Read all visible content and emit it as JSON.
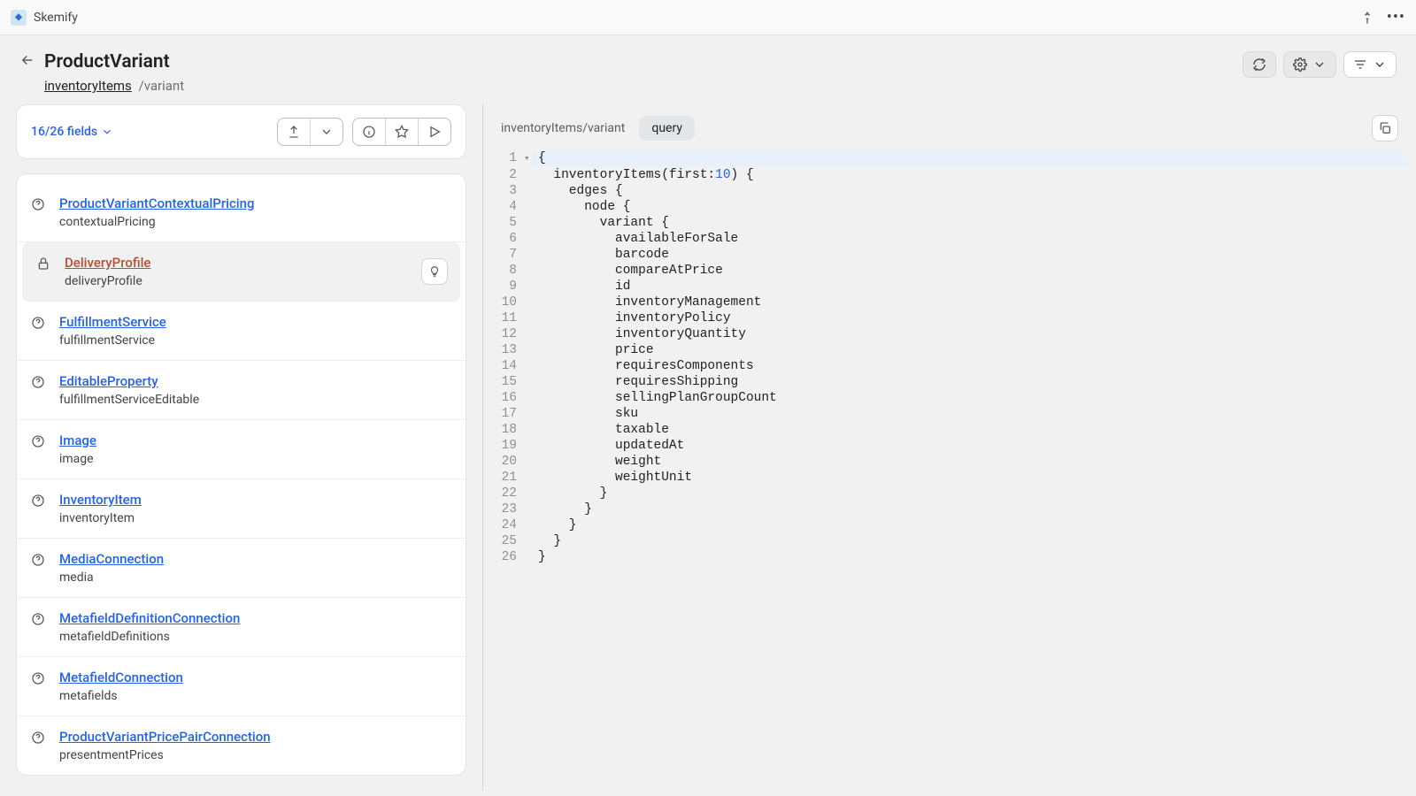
{
  "app": {
    "name": "Skemify"
  },
  "header": {
    "title": "ProductVariant",
    "breadcrumb_link": "inventoryItems",
    "breadcrumb_suffix": " /variant"
  },
  "fields_panel": {
    "count_label": "16/26 fields"
  },
  "fields": [
    {
      "type": "ProductVariantContextualPricing",
      "name": "contextualPricing",
      "icon": "help",
      "selected": false
    },
    {
      "type": "DeliveryProfile",
      "name": "deliveryProfile",
      "icon": "lock",
      "selected": true,
      "key_badge": true
    },
    {
      "type": "FulfillmentService",
      "name": "fulfillmentService",
      "icon": "help",
      "selected": false
    },
    {
      "type": "EditableProperty",
      "name": "fulfillmentServiceEditable",
      "icon": "help",
      "selected": false
    },
    {
      "type": "Image",
      "name": "image",
      "icon": "help",
      "selected": false
    },
    {
      "type": "InventoryItem",
      "name": "inventoryItem",
      "icon": "help",
      "selected": false
    },
    {
      "type": "MediaConnection",
      "name": "media",
      "icon": "help",
      "selected": false
    },
    {
      "type": "MetafieldDefinitionConnection",
      "name": "metafieldDefinitions",
      "icon": "help",
      "selected": false
    },
    {
      "type": "MetafieldConnection",
      "name": "metafields",
      "icon": "help",
      "selected": false
    },
    {
      "type": "ProductVariantPricePairConnection",
      "name": "presentmentPrices",
      "icon": "help",
      "selected": false
    }
  ],
  "query": {
    "path_label": "inventoryItems/variant",
    "tab_label": "query"
  },
  "code_lines": [
    {
      "n": 1,
      "fold": "",
      "text": "{",
      "hl": true
    },
    {
      "n": 2,
      "fold": "",
      "text": "  inventoryItems(first:",
      "num": "10",
      "tail": ") {"
    },
    {
      "n": 3,
      "fold": "",
      "text": "    edges {"
    },
    {
      "n": 4,
      "fold": "",
      "text": "      node {"
    },
    {
      "n": 5,
      "fold": "",
      "text": "        variant {"
    },
    {
      "n": 6,
      "fold": "",
      "text": "          availableForSale"
    },
    {
      "n": 7,
      "fold": "",
      "text": "          barcode"
    },
    {
      "n": 8,
      "fold": "",
      "text": "          compareAtPrice"
    },
    {
      "n": 9,
      "fold": "",
      "text": "          id"
    },
    {
      "n": 10,
      "fold": "",
      "text": "          inventoryManagement"
    },
    {
      "n": 11,
      "fold": "",
      "text": "          inventoryPolicy"
    },
    {
      "n": 12,
      "fold": "",
      "text": "          inventoryQuantity"
    },
    {
      "n": 13,
      "fold": "",
      "text": "          price"
    },
    {
      "n": 14,
      "fold": "",
      "text": "          requiresComponents"
    },
    {
      "n": 15,
      "fold": "",
      "text": "          requiresShipping"
    },
    {
      "n": 16,
      "fold": "",
      "text": "          sellingPlanGroupCount"
    },
    {
      "n": 17,
      "fold": "",
      "text": "          sku"
    },
    {
      "n": 18,
      "fold": "",
      "text": "          taxable"
    },
    {
      "n": 19,
      "fold": "",
      "text": "          updatedAt"
    },
    {
      "n": 20,
      "fold": "",
      "text": "          weight"
    },
    {
      "n": 21,
      "fold": "",
      "text": "          weightUnit"
    },
    {
      "n": 22,
      "fold": "",
      "text": "        }"
    },
    {
      "n": 23,
      "fold": "",
      "text": "      }"
    },
    {
      "n": 24,
      "fold": "",
      "text": "    }"
    },
    {
      "n": 25,
      "fold": "",
      "text": "  }"
    },
    {
      "n": 26,
      "fold": "",
      "text": "}"
    }
  ]
}
